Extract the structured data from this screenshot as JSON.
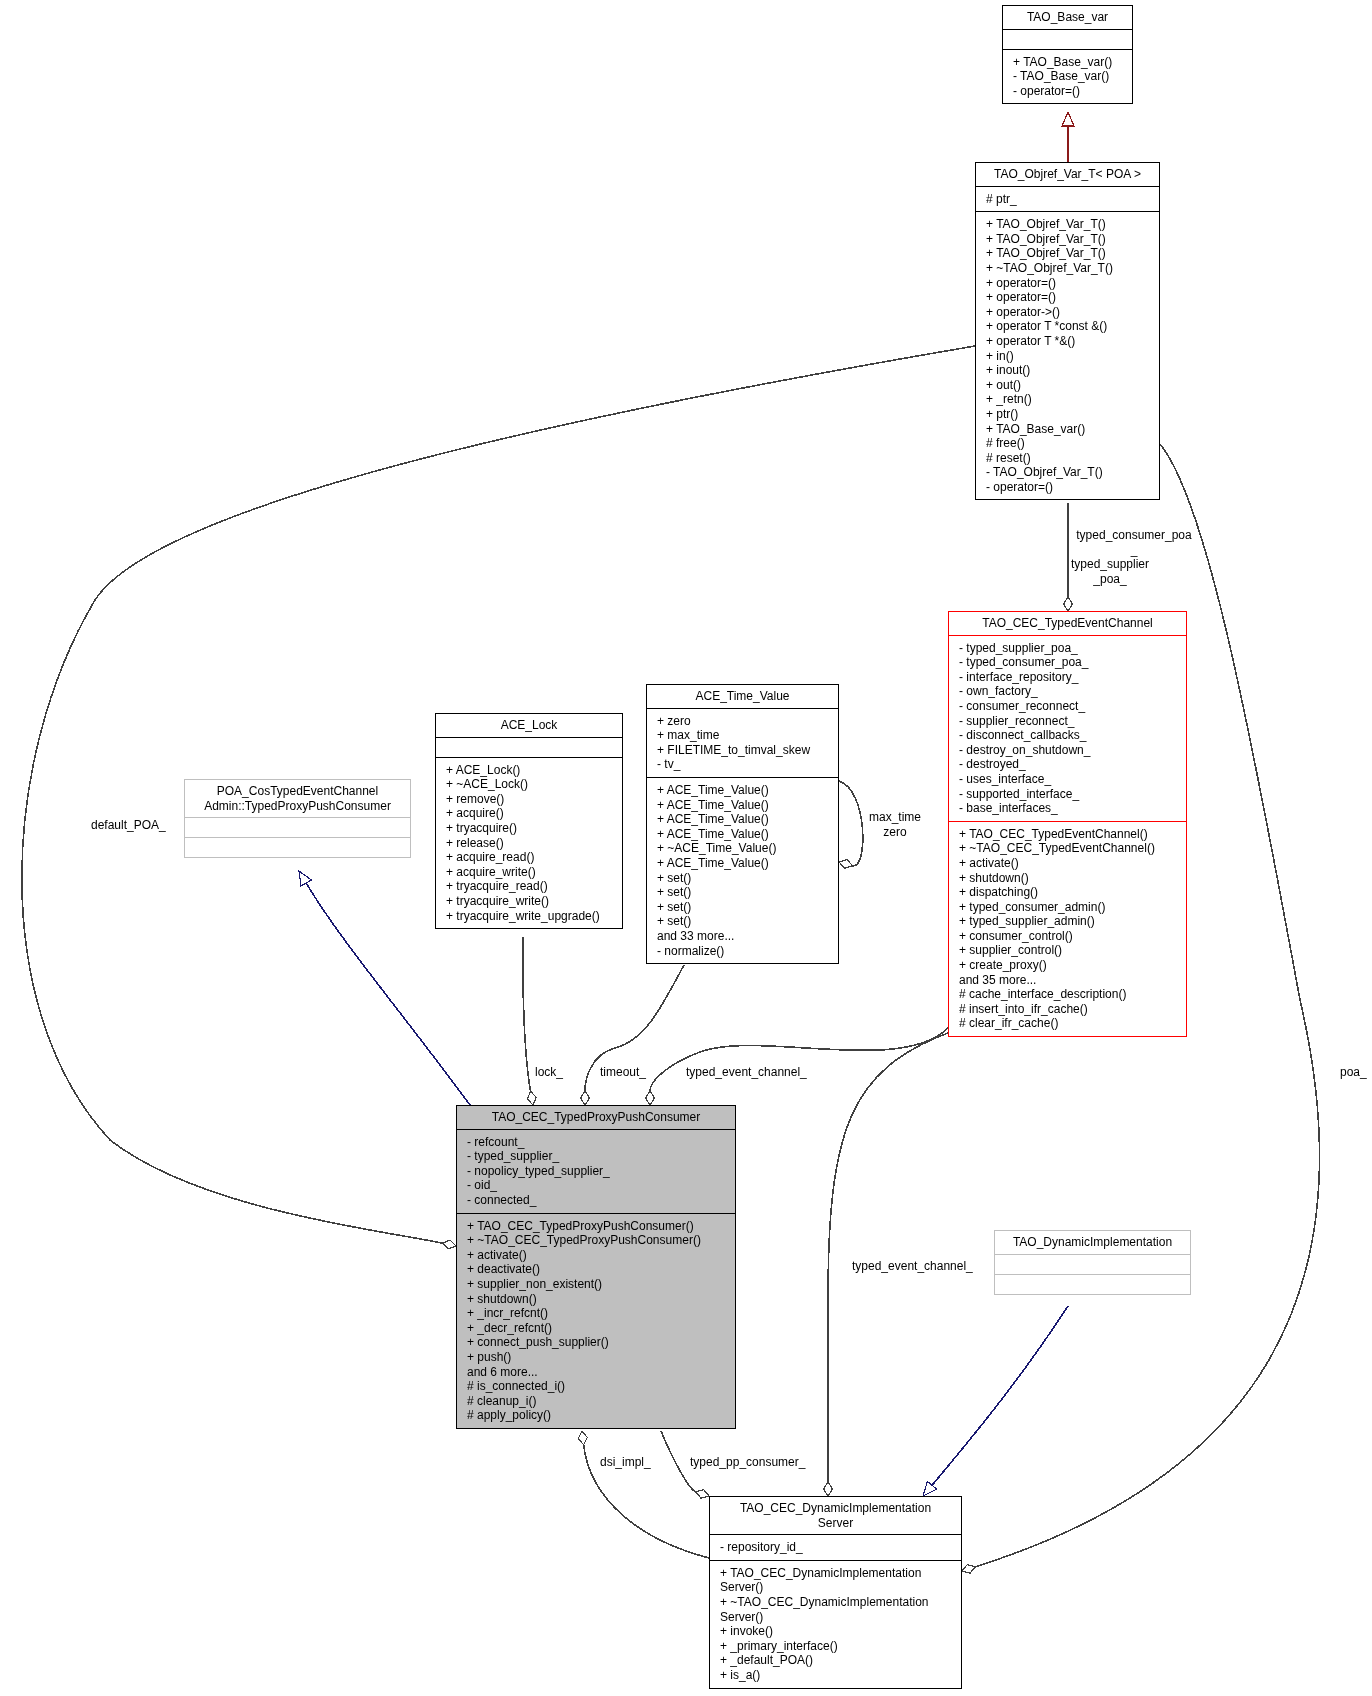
{
  "nodes": [
    {
      "kind": "normal",
      "title": [
        "TAO_Base_var"
      ],
      "methods": [
        "+ TAO_Base_var()",
        "- TAO_Base_var()",
        "- operator=()"
      ]
    },
    {
      "kind": "normal",
      "title": [
        "TAO_Objref_Var_T< POA >"
      ],
      "attributes": [
        "# ptr_"
      ],
      "methods": [
        "+ TAO_Objref_Var_T()",
        "+ TAO_Objref_Var_T()",
        "+ TAO_Objref_Var_T()",
        "+ ~TAO_Objref_Var_T()",
        "+ operator=()",
        "+ operator=()",
        "+ operator->()",
        "+ operator T *const &()",
        "+ operator T *&()",
        "+ in()",
        "+ inout()",
        "+ out()",
        "+ _retn()",
        "+ ptr()",
        "+ TAO_Base_var()",
        "# free()",
        "# reset()",
        "- TAO_Objref_Var_T()",
        "- operator=()"
      ]
    },
    {
      "kind": "external",
      "title": [
        "POA_CosTypedEventChannel",
        "Admin::TypedProxyPushConsumer"
      ]
    },
    {
      "kind": "normal",
      "title": [
        "ACE_Lock"
      ],
      "methods": [
        "+ ACE_Lock()",
        "+ ~ACE_Lock()",
        "+ remove()",
        "+ acquire()",
        "+ tryacquire()",
        "+ release()",
        "+ acquire_read()",
        "+ acquire_write()",
        "+ tryacquire_read()",
        "+ tryacquire_write()",
        "+ tryacquire_write_upgrade()"
      ]
    },
    {
      "kind": "normal",
      "title": [
        "ACE_Time_Value"
      ],
      "attributes": [
        "+ zero",
        "+ max_time",
        "+ FILETIME_to_timval_skew",
        "- tv_"
      ],
      "methods": [
        "+ ACE_Time_Value()",
        "+ ACE_Time_Value()",
        "+ ACE_Time_Value()",
        "+ ACE_Time_Value()",
        "+ ~ACE_Time_Value()",
        "+ ACE_Time_Value()",
        "+ set()",
        "+ set()",
        "+ set()",
        "+ set()",
        "and 33 more...",
        "- normalize()"
      ]
    },
    {
      "kind": "highlight",
      "title": [
        "TAO_CEC_TypedEventChannel"
      ],
      "attributes": [
        "- typed_supplier_poa_",
        "- typed_consumer_poa_",
        "- interface_repository_",
        "- own_factory_",
        "- consumer_reconnect_",
        "- supplier_reconnect_",
        "- disconnect_callbacks_",
        "- destroy_on_shutdown_",
        "- destroyed_",
        "- uses_interface_",
        "- supported_interface_",
        "- base_interfaces_"
      ],
      "methods": [
        "+ TAO_CEC_TypedEventChannel()",
        "+ ~TAO_CEC_TypedEventChannel()",
        "+ activate()",
        "+ shutdown()",
        "+ dispatching()",
        "+ typed_consumer_admin()",
        "+ typed_supplier_admin()",
        "+ consumer_control()",
        "+ supplier_control()",
        "+ create_proxy()",
        "and 35 more...",
        "# cache_interface_description()",
        "# insert_into_ifr_cache()",
        "# clear_ifr_cache()"
      ]
    },
    {
      "kind": "focus",
      "title": [
        "TAO_CEC_TypedProxyPushConsumer"
      ],
      "attributes": [
        "- refcount_",
        "- typed_supplier_",
        "- nopolicy_typed_supplier_",
        "- oid_",
        "- connected_"
      ],
      "methods": [
        "+ TAO_CEC_TypedProxyPushConsumer()",
        "+ ~TAO_CEC_TypedProxyPushConsumer()",
        "+ activate()",
        "+ deactivate()",
        "+ supplier_non_existent()",
        "+ shutdown()",
        "+ _incr_refcnt()",
        "+ _decr_refcnt()",
        "+ connect_push_supplier()",
        "+ push()",
        "and 6 more...",
        "# is_connected_i()",
        "# cleanup_i()",
        "# apply_policy()"
      ]
    },
    {
      "kind": "external",
      "title": [
        "TAO_DynamicImplementation"
      ]
    },
    {
      "kind": "normal",
      "title": [
        "TAO_CEC_DynamicImplementation",
        "Server"
      ],
      "attributes": [
        "- repository_id_"
      ],
      "methods": [
        "+ TAO_CEC_DynamicImplementation\nServer()",
        "+ ~TAO_CEC_DynamicImplementation\nServer()",
        "+ invoke()",
        "+ _primary_interface()",
        "+ _default_POA()",
        "+ is_a()"
      ]
    }
  ],
  "edges": [
    {
      "kind": "inheritance",
      "color": "#8b1a1a"
    },
    {
      "kind": "aggregation",
      "color": "#404040",
      "labels": [
        "typed_consumer_poa\n_",
        "typed_supplier\n_poa_"
      ]
    },
    {
      "kind": "aggregation",
      "color": "#404040",
      "labels": [
        "default_POA_"
      ]
    },
    {
      "kind": "aggregation",
      "color": "#404040",
      "labels": [
        "max_time\nzero"
      ]
    },
    {
      "kind": "inheritance",
      "color": "#191970"
    },
    {
      "kind": "aggregation",
      "color": "#404040",
      "labels": [
        "lock_"
      ]
    },
    {
      "kind": "aggregation",
      "color": "#404040",
      "labels": [
        "timeout_"
      ]
    },
    {
      "kind": "aggregation",
      "color": "#404040",
      "labels": [
        "typed_event_channel_"
      ]
    },
    {
      "kind": "aggregation",
      "color": "#404040",
      "labels": [
        "poa_"
      ]
    },
    {
      "kind": "aggregation",
      "color": "#404040",
      "labels": [
        "typed_event_channel_"
      ]
    },
    {
      "kind": "inheritance",
      "color": "#191970"
    },
    {
      "kind": "aggregation",
      "color": "#404040",
      "labels": [
        "dsi_impl_"
      ]
    },
    {
      "kind": "aggregation",
      "color": "#404040",
      "labels": [
        "typed_pp_consumer_"
      ]
    }
  ]
}
